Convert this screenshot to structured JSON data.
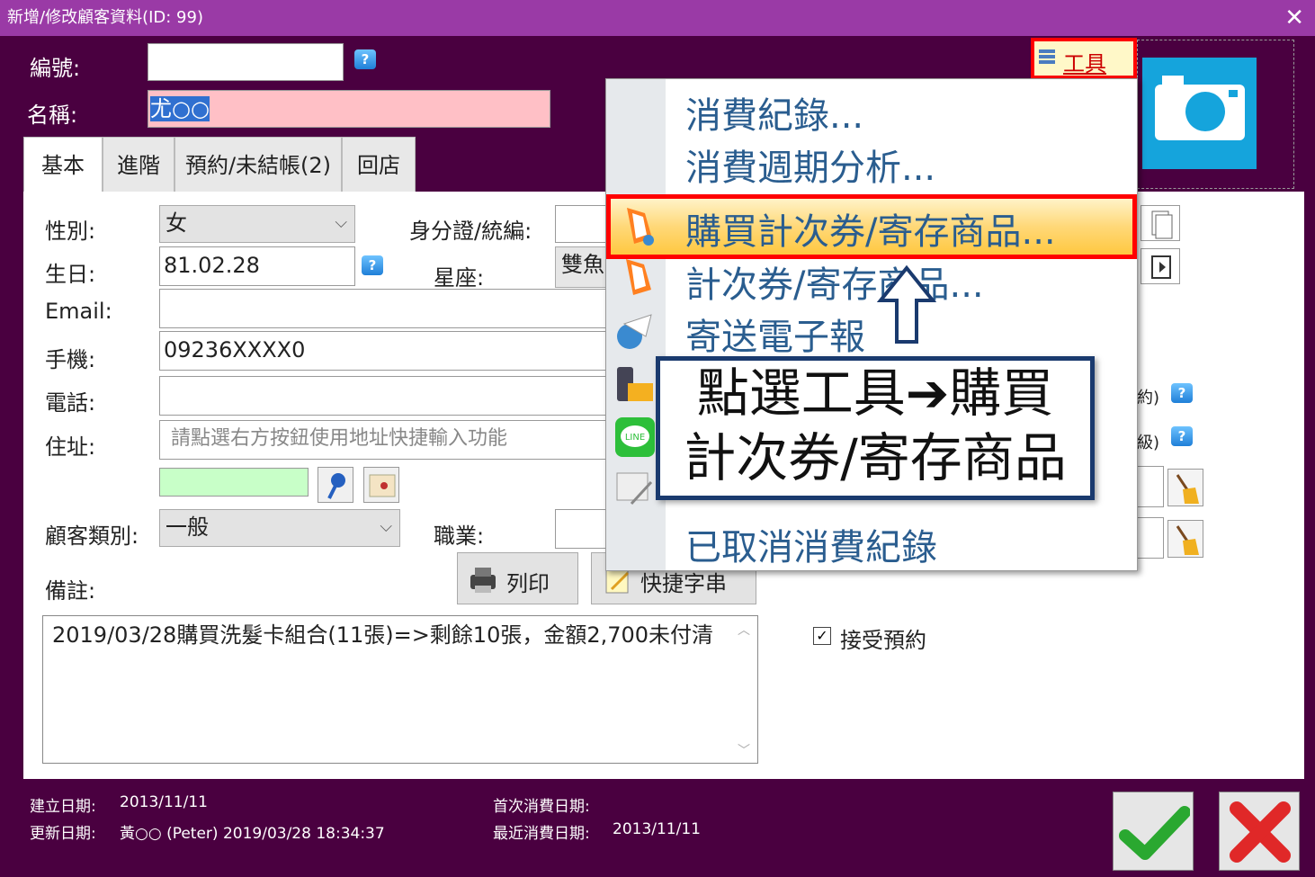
{
  "window": {
    "title": "新增/修改顧客資料(ID: 99)",
    "close": "✕"
  },
  "header": {
    "id_label": "編號:",
    "id_value": "",
    "name_label": "名稱:",
    "name_value": "尤○○"
  },
  "tools_menu": {
    "label": "工具"
  },
  "tabs": [
    {
      "label": "基本"
    },
    {
      "label": "進階"
    },
    {
      "label": "預約/未結帳(2)"
    },
    {
      "label": "回店"
    }
  ],
  "form": {
    "gender_label": "性別:",
    "gender_value": "女",
    "id_card_label": "身分證/統編:",
    "birthday_label": "生日:",
    "birthday_value": "81.02.28",
    "zodiac_label": "星座:",
    "zodiac_value": "雙魚",
    "email_label": "Email:",
    "email_value": "",
    "mobile_label": "手機:",
    "mobile_value": "09236XXXX0",
    "phone_label": "電話:",
    "phone_value": "",
    "address_label": "住址:",
    "address_placeholder": "請點選右方按鈕使用地址快捷輸入功能",
    "category_label": "顧客類別:",
    "category_value": "一般",
    "job_label": "職業:",
    "note_label": "備註:",
    "print_button": "列印",
    "quick_button": "快捷字串",
    "note_value": "2019/03/28購買洗髮卡組合(11張)=>剩餘10張，金額2,700未付清",
    "accept_booking": "接受預約",
    "partial_1": "約)",
    "partial_2": "級)"
  },
  "dropdown_menu": {
    "items": [
      {
        "label": "消費紀錄..."
      },
      {
        "label": "消費週期分析..."
      },
      {
        "label": "購買計次券/寄存商品..."
      },
      {
        "label": "計次券/寄存商品..."
      },
      {
        "label": "寄送電子報"
      },
      {
        "label": ""
      },
      {
        "label": ""
      },
      {
        "label": ""
      },
      {
        "label": "已取消消費紀錄"
      }
    ],
    "line_label": "LINE"
  },
  "callout": {
    "line1": "點選工具➔購買",
    "line2": "計次券/寄存商品"
  },
  "status": {
    "created_label": "建立日期:",
    "created_value": "2013/11/11",
    "updated_label": "更新日期:",
    "updated_value": "黃○○ (Peter) 2019/03/28 18:34:37",
    "first_label": "首次消費日期:",
    "first_value": "",
    "last_label": "最近消費日期:",
    "last_value": "2013/11/11"
  },
  "colors": {
    "accent": "#9a3aa6",
    "background": "#4a0040",
    "highlight": "#ff0000",
    "callout_border": "#1a3a6e"
  }
}
